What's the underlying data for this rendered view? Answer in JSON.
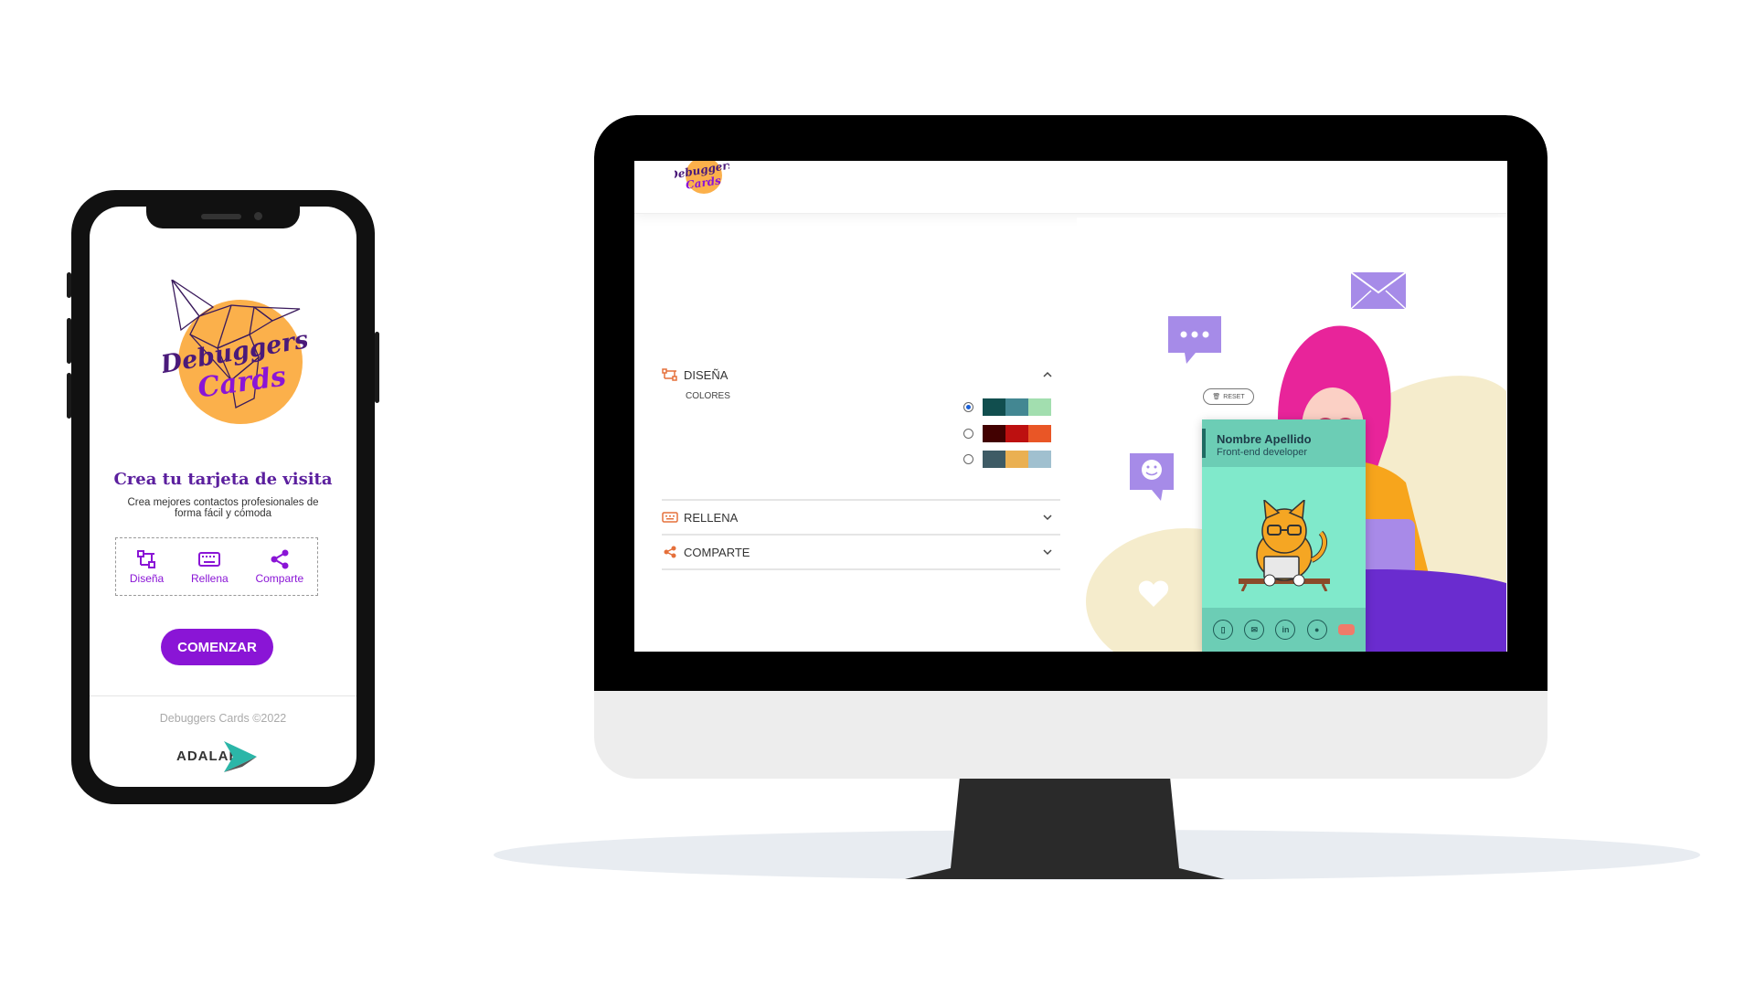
{
  "mobile": {
    "logo_text": "Debuggers Cards",
    "title": "Crea tu tarjeta de visita",
    "subtitle": "Crea mejores contactos profesionales de forma fácil y cómoda",
    "steps": [
      {
        "label": "Diseña",
        "icon": "design-icon"
      },
      {
        "label": "Rellena",
        "icon": "keyboard-icon"
      },
      {
        "label": "Comparte",
        "icon": "share-icon"
      }
    ],
    "start_button": "COMENZAR",
    "footer": "Debuggers Cards ©2022",
    "brand": "ADALAB"
  },
  "desktop": {
    "logo_text": "Debuggers Cards",
    "sections": {
      "design": "DISEÑA",
      "colors_label": "COLORES",
      "fill": "RELLENA",
      "share": "COMPARTE"
    },
    "palettes": [
      {
        "selected": true,
        "colors": [
          "#114e4e",
          "#438792",
          "#a2deaf"
        ]
      },
      {
        "selected": false,
        "colors": [
          "#420101",
          "#bd1010",
          "#e95626"
        ]
      },
      {
        "selected": false,
        "colors": [
          "#3e5b65",
          "#eab052",
          "#a0c0cf"
        ]
      }
    ],
    "reset_label": "RESET",
    "card": {
      "name": "Nombre Apellido",
      "job": "Front-end developer",
      "icons": [
        "phone-icon",
        "mail-icon",
        "linkedin-icon",
        "github-icon",
        "avatar-icon"
      ]
    }
  },
  "colors": {
    "accent": "#8a15d6",
    "title_purple": "#5b1f9e",
    "card_bg": "#80e9cb",
    "card_header": "#6ccdb5",
    "section_orange": "#e5703b"
  }
}
